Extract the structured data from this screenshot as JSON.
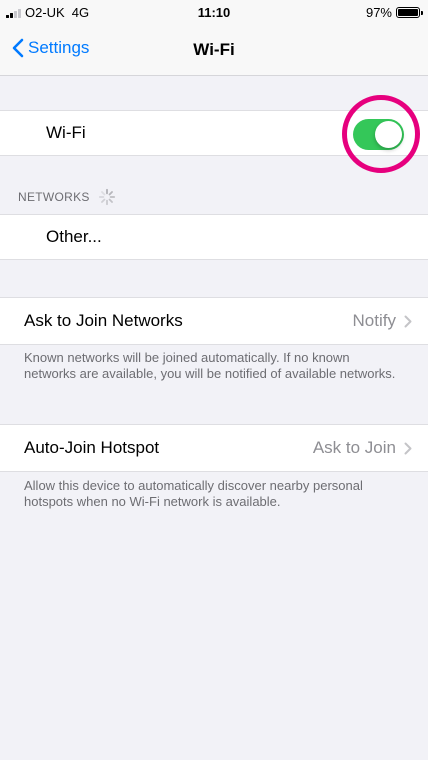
{
  "status_bar": {
    "carrier": "O2-UK",
    "network": "4G",
    "time": "11:10",
    "battery": "97%"
  },
  "nav": {
    "back_label": "Settings",
    "title": "Wi-Fi"
  },
  "wifi": {
    "label": "Wi-Fi",
    "enabled": true
  },
  "networks": {
    "header": "NETWORKS",
    "other_label": "Other..."
  },
  "ask_to_join": {
    "label": "Ask to Join Networks",
    "value": "Notify",
    "footer": "Known networks will be joined automatically. If no known networks are available, you will be notified of available networks."
  },
  "auto_join_hotspot": {
    "label": "Auto-Join Hotspot",
    "value": "Ask to Join",
    "footer": "Allow this device to automatically discover nearby personal hotspots when no Wi-Fi network is available."
  },
  "colors": {
    "accent": "#007aff",
    "toggle_on": "#34c759",
    "highlight": "#e6007e"
  }
}
